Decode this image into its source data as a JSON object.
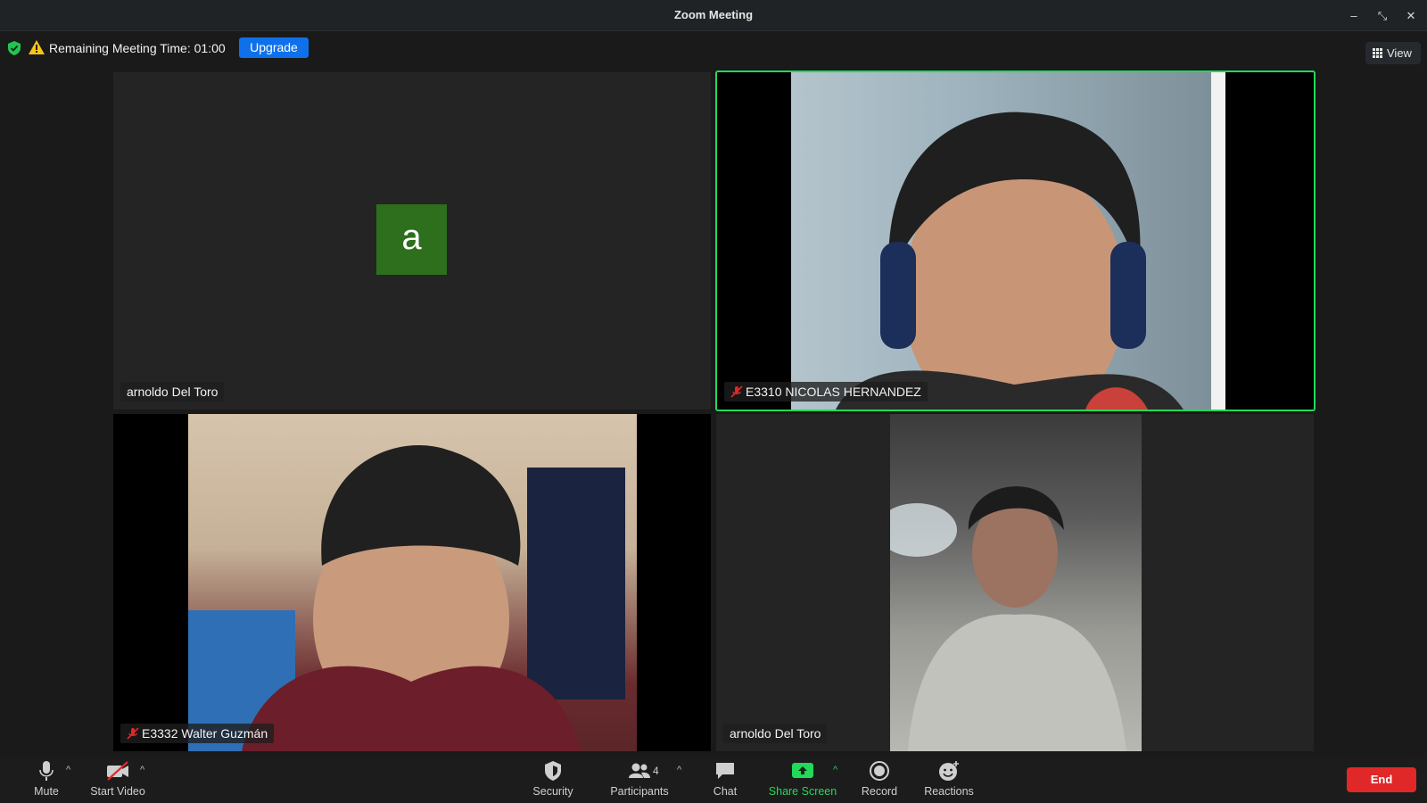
{
  "window": {
    "title": "Zoom Meeting",
    "controls": {
      "minimize": "–",
      "restore": "⤡",
      "close": "✕"
    }
  },
  "banner": {
    "remaining_text": "Remaining Meeting Time: 01:00",
    "upgrade_label": "Upgrade",
    "view_label": "View"
  },
  "tiles": [
    {
      "name": "arnoldo Del Toro",
      "avatar_letter": "a",
      "muted": false,
      "video": false,
      "active_speaker": false
    },
    {
      "name": "E3310 NICOLAS HERNANDEZ",
      "muted": true,
      "video": true,
      "active_speaker": true
    },
    {
      "name": "E3332 Walter Guzmán",
      "muted": true,
      "video": true,
      "active_speaker": false
    },
    {
      "name": "arnoldo Del Toro",
      "muted": false,
      "video": true,
      "active_speaker": false
    }
  ],
  "toolbar": {
    "mute_label": "Mute",
    "start_video_label": "Start Video",
    "security_label": "Security",
    "participants_label": "Participants",
    "participants_count": "4",
    "chat_label": "Chat",
    "share_label": "Share Screen",
    "record_label": "Record",
    "reactions_label": "Reactions",
    "end_label": "End"
  },
  "colors": {
    "accent_blue": "#0e71eb",
    "active_speaker_border": "#23d959",
    "share_green": "#23d959",
    "end_red": "#e02828",
    "avatar_green": "#2d6f1c"
  },
  "icons": [
    "shield-icon",
    "warning-icon",
    "grid-icon",
    "muted-mic-icon",
    "mic-icon",
    "video-off-icon",
    "security-shield-icon",
    "participants-icon",
    "chat-icon",
    "share-screen-icon",
    "record-icon",
    "reactions-icon",
    "chevron-up-icon"
  ]
}
